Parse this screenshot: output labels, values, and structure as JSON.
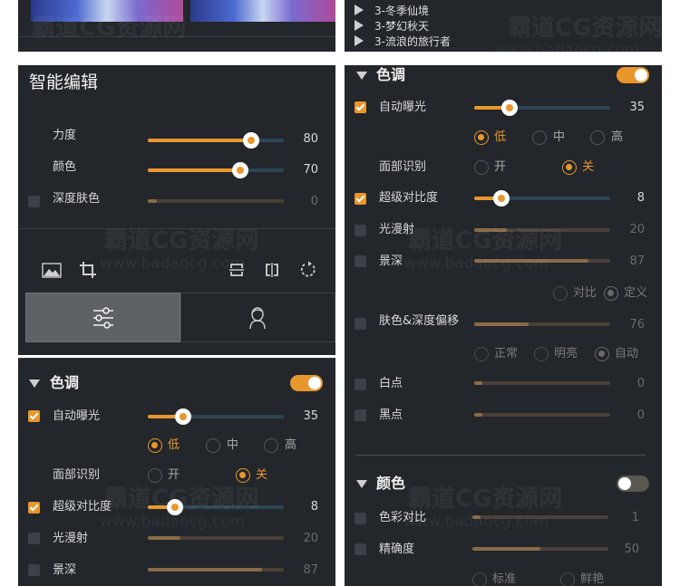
{
  "watermark": {
    "main": "霸道CG资源网",
    "sub": "www.badaocg.com"
  },
  "top_left": {
    "thumbnails": [
      "",
      ""
    ]
  },
  "top_right": {
    "list_items": [
      "3-冬季仙境",
      "3-梦幻秋天",
      "3-流浪的旅行者"
    ]
  },
  "left": {
    "title": "智能编辑",
    "sliders": [
      {
        "label": "力度",
        "value": "80",
        "fraction": 0.76,
        "enabled": true,
        "has_checkbox": false
      },
      {
        "label": "颜色",
        "value": "70",
        "fraction": 0.68,
        "enabled": true,
        "has_checkbox": false
      },
      {
        "label": "深度肤色",
        "value": "0",
        "fraction": 0.0,
        "enabled": false,
        "has_checkbox": true,
        "checked": false
      }
    ],
    "tools": [
      "image-icon",
      "crop-icon",
      "flip-vertical-icon",
      "flip-horizontal-icon",
      "rotate-icon"
    ],
    "tabs": [
      {
        "name": "adjust-sliders-icon",
        "active": true
      },
      {
        "name": "portrait-icon",
        "active": false
      }
    ],
    "tone": {
      "title": "色调",
      "toggle_on": true,
      "auto_exposure": {
        "label": "自动曝光",
        "value": "35",
        "fraction": 0.26,
        "checked": true
      },
      "exposure_levels": [
        "低",
        "中",
        "高"
      ],
      "exposure_selected": "低",
      "face_label": "面部识别",
      "face_options": [
        "开",
        "关"
      ],
      "face_selected": "关",
      "super_contrast": {
        "label": "超级对比度",
        "value": "8",
        "fraction": 0.2,
        "checked": true
      },
      "diffusion": {
        "label": "光漫射",
        "value": "20",
        "fraction": 0.24,
        "checked": false
      },
      "depth": {
        "label": "景深",
        "value": "87",
        "fraction": 0.84,
        "checked": false
      }
    }
  },
  "right": {
    "tone": {
      "title": "色调",
      "toggle_on": true,
      "auto_exposure": {
        "label": "自动曝光",
        "value": "35",
        "fraction": 0.26,
        "checked": true
      },
      "exposure_levels": [
        "低",
        "中",
        "高"
      ],
      "exposure_selected": "低",
      "face_label": "面部识别",
      "face_options": [
        "开",
        "关"
      ],
      "face_selected": "关",
      "super_contrast": {
        "label": "超级对比度",
        "value": "8",
        "fraction": 0.2,
        "checked": true
      },
      "diffusion": {
        "label": "光漫射",
        "value": "20",
        "fraction": 0.24,
        "checked": false
      },
      "depth": {
        "label": "景深",
        "value": "87",
        "fraction": 0.84,
        "checked": false
      },
      "depth_mode_options": [
        "对比",
        "定义"
      ],
      "depth_mode_selected": "定义",
      "skin_depth": {
        "label": "肤色&深度偏移",
        "value": "76",
        "fraction": 0.4,
        "checked": false
      },
      "skin_mode_options": [
        "正常",
        "明亮",
        "自动"
      ],
      "skin_mode_selected": "自动",
      "white_point": {
        "label": "白点",
        "value": "0",
        "fraction": 0.0,
        "checked": false
      },
      "black_point": {
        "label": "黑点",
        "value": "0",
        "fraction": 0.0,
        "checked": false
      }
    },
    "color": {
      "title": "颜色",
      "toggle_on": false,
      "contrast": {
        "label": "色彩对比",
        "value": "1",
        "fraction": 0.05,
        "checked": false
      },
      "precision": {
        "label": "精确度",
        "value": "50",
        "fraction": 0.5,
        "checked": false
      },
      "mode_options": [
        "标准",
        "鲜艳"
      ]
    }
  },
  "colors": {
    "accent": "#e8972d",
    "panel_bg": "#23262b",
    "track": "#2d4656"
  }
}
